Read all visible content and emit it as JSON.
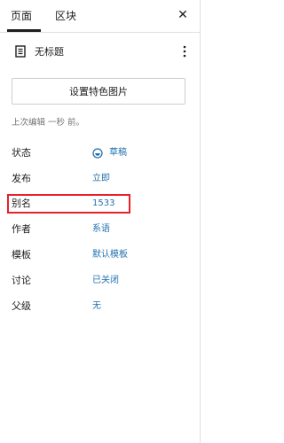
{
  "tabs": {
    "page_label": "页面",
    "block_label": "区块",
    "close_glyph": "✕"
  },
  "document": {
    "title": "无标题"
  },
  "featured_image": {
    "button_label": "设置特色图片"
  },
  "last_edited": "上次编辑 一秒 前。",
  "properties": {
    "status": {
      "label": "状态",
      "value": "草稿"
    },
    "publish": {
      "label": "发布",
      "value": "立即"
    },
    "slug": {
      "label": "别名",
      "value": "1533"
    },
    "author": {
      "label": "作者",
      "value": "系语"
    },
    "template": {
      "label": "模板",
      "value": "默认模板"
    },
    "discussion": {
      "label": "讨论",
      "value": "已关闭"
    },
    "parent": {
      "label": "父级",
      "value": "无"
    }
  },
  "colors": {
    "link": "#2271b1",
    "highlight": "#e8202a",
    "muted": "#757575",
    "text": "#1e1e1e"
  }
}
